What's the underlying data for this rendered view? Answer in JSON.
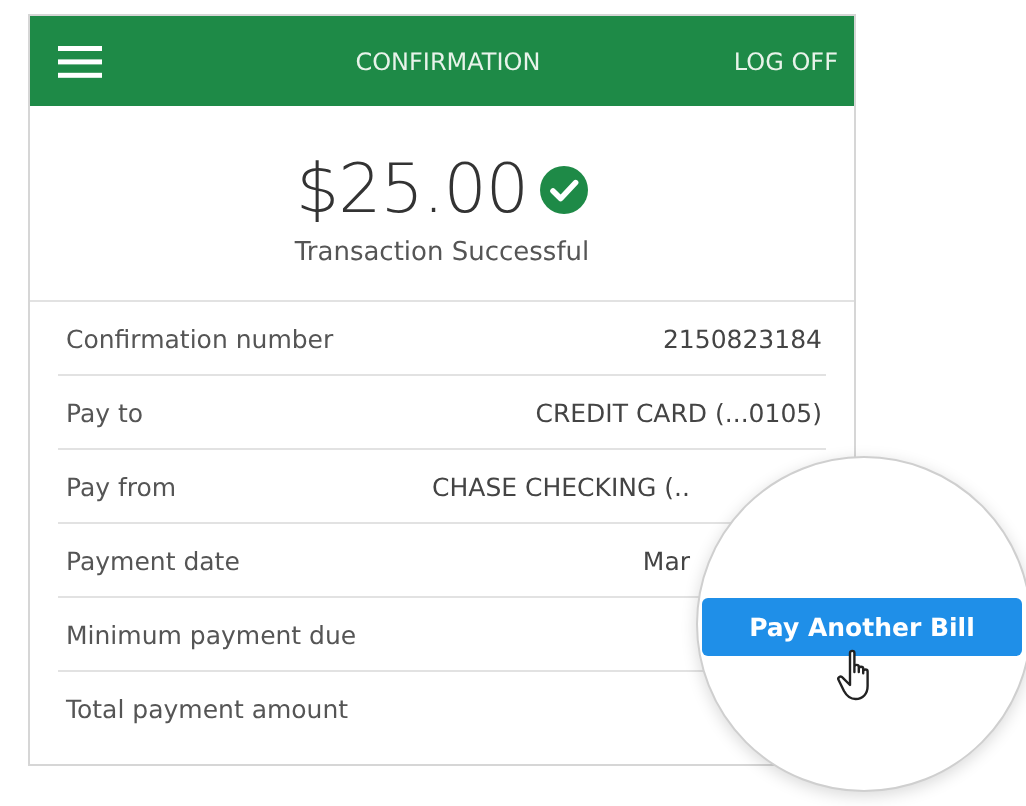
{
  "header": {
    "title": "CONFIRMATION",
    "action": "LOG OFF"
  },
  "amount": "$25.00",
  "status": "Transaction Successful",
  "details": [
    {
      "label": "Confirmation number",
      "value": "2150823184",
      "kind": "full"
    },
    {
      "label": "Pay to",
      "value": "CREDIT CARD (...0105)",
      "kind": "full"
    },
    {
      "label": "Pay from",
      "value": "CHASE CHECKING (..",
      "kind": "covered"
    },
    {
      "label": "Payment date",
      "value": "Mar",
      "kind": "covered"
    },
    {
      "label": "Minimum payment due"
    },
    {
      "label": "Total payment amount"
    }
  ],
  "magnifier": {
    "button": "Pay Another Bill"
  }
}
